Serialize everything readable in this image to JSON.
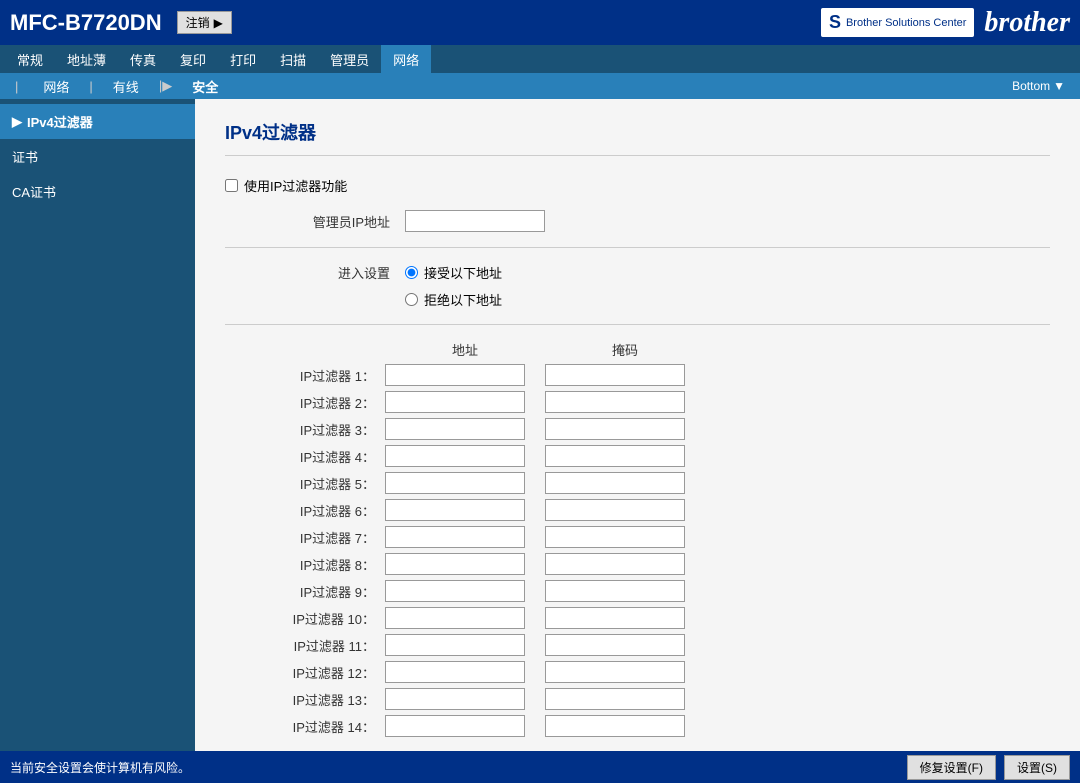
{
  "header": {
    "title": "MFC-B7720DN",
    "logout_label": "注销",
    "brother_logo": "brother",
    "solutions_label": "Brother Solutions Center"
  },
  "nav": {
    "tabs": [
      {
        "label": "常规",
        "active": false
      },
      {
        "label": "地址薄",
        "active": false
      },
      {
        "label": "传真",
        "active": false
      },
      {
        "label": "复印",
        "active": false
      },
      {
        "label": "打印",
        "active": false
      },
      {
        "label": "扫描",
        "active": false
      },
      {
        "label": "管理员",
        "active": false
      },
      {
        "label": "网络",
        "active": true
      }
    ],
    "sub_tabs": [
      {
        "label": "网络",
        "active": false
      },
      {
        "label": "有线",
        "active": false
      },
      {
        "label": "安全",
        "active": true
      }
    ],
    "bottom_label": "Bottom"
  },
  "sidebar": {
    "items": [
      {
        "label": "IPv4过滤器",
        "active": true
      },
      {
        "label": "证书",
        "active": false
      },
      {
        "label": "CA证书",
        "active": false
      }
    ]
  },
  "page": {
    "title": "IPv4过滤器",
    "use_filter_label": "使用IP过滤器功能",
    "admin_ip_label": "管理员IP地址",
    "admin_ip_value": "",
    "incoming_label": "进入设置",
    "radio_accept": "接受以下地址",
    "radio_reject": "拒绝以下地址",
    "col_address": "地址",
    "col_mask": "掩码",
    "filters": [
      {
        "label": "IP过滤器 1：",
        "addr": "",
        "mask": ""
      },
      {
        "label": "IP过滤器 2：",
        "addr": "",
        "mask": ""
      },
      {
        "label": "IP过滤器 3：",
        "addr": "",
        "mask": ""
      },
      {
        "label": "IP过滤器 4：",
        "addr": "",
        "mask": ""
      },
      {
        "label": "IP过滤器 5：",
        "addr": "",
        "mask": ""
      },
      {
        "label": "IP过滤器 6：",
        "addr": "",
        "mask": ""
      },
      {
        "label": "IP过滤器 7：",
        "addr": "",
        "mask": ""
      },
      {
        "label": "IP过滤器 8：",
        "addr": "",
        "mask": ""
      },
      {
        "label": "IP过滤器 9：",
        "addr": "",
        "mask": ""
      },
      {
        "label": "IP过滤器 10：",
        "addr": "",
        "mask": ""
      },
      {
        "label": "IP过滤器 11：",
        "addr": "",
        "mask": ""
      },
      {
        "label": "IP过滤器 12：",
        "addr": "",
        "mask": ""
      },
      {
        "label": "IP过滤器 13：",
        "addr": "",
        "mask": ""
      },
      {
        "label": "IP过滤器 14：",
        "addr": "",
        "mask": ""
      }
    ]
  },
  "status_bar": {
    "text": "当前安全设置会使计算机有风险。",
    "fix_btn": "修复设置(F)",
    "settings_btn": "设置(S)"
  }
}
